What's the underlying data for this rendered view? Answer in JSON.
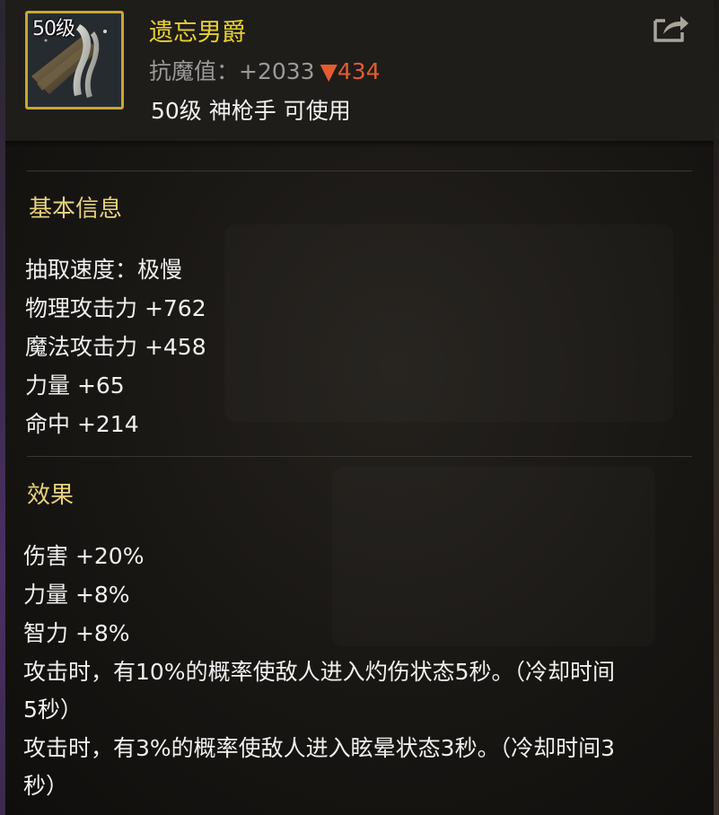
{
  "item": {
    "level_badge": "50级",
    "name": "遗忘男爵",
    "resist_label": "抗魔值：",
    "resist_value": "+2033",
    "resist_change": "▼434",
    "class_line": "50级 神枪手 可使用",
    "icon": "gun-icon"
  },
  "header": {
    "share_icon": "share-icon"
  },
  "sections": {
    "basic": {
      "title": "基本信息",
      "stats": [
        "抽取速度：极慢",
        "物理攻击力 +762",
        "魔法攻击力 +458",
        "力量 +65",
        "命中 +214"
      ]
    },
    "effects": {
      "title": "效果",
      "lines": [
        "伤害 +20%",
        "力量 +8%",
        "智力 +8%",
        "攻击时，有10%的概率使敌人进入灼伤状态5秒。（冷却时间",
        "5秒）",
        "攻击时，有3%的概率使敌人进入眩晕状态3秒。（冷却时间3",
        "秒）"
      ]
    }
  },
  "colors": {
    "name": "#e7d02f",
    "section_title": "#e5d27a",
    "resist_down": "#e25c2f",
    "icon_frame": "#c8a82e"
  }
}
